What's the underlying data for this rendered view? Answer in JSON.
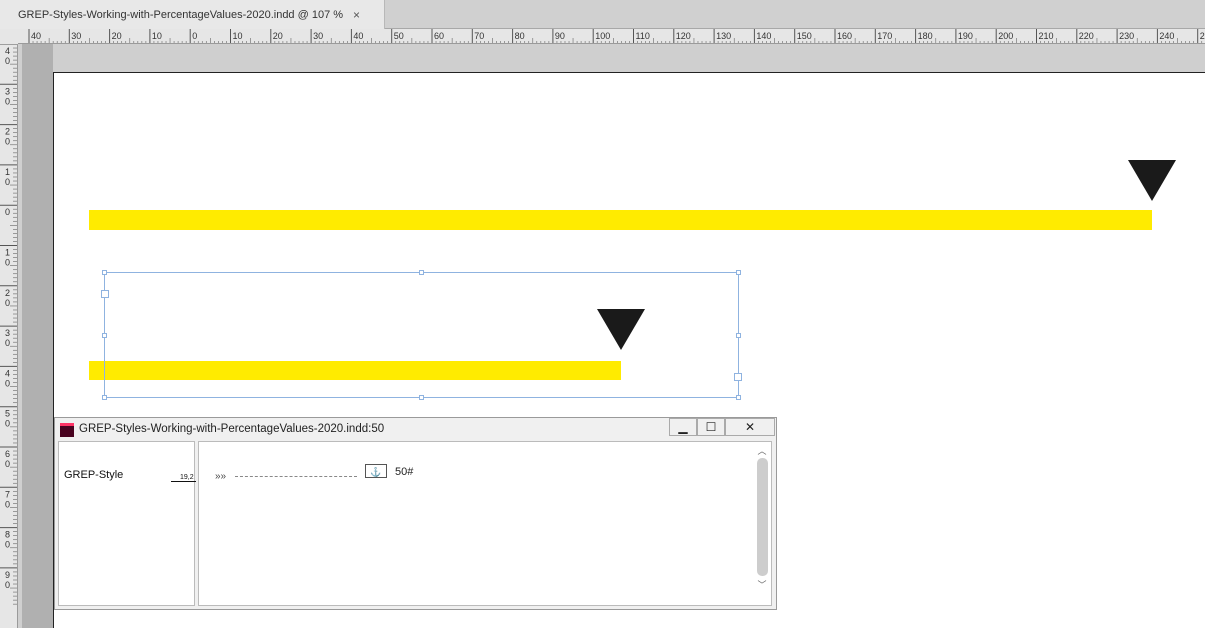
{
  "document_tab": {
    "title": "GREP-Styles-Working-with-PercentageValues-2020.indd @ 107 %",
    "close": "×"
  },
  "ruler": {
    "horizontal_labels": [
      "40",
      "30",
      "20",
      "10",
      "0",
      "10",
      "20",
      "30",
      "40",
      "50",
      "60",
      "70",
      "80",
      "90",
      "100",
      "110",
      "120",
      "130",
      "140",
      "150",
      "160",
      "170",
      "180",
      "190",
      "200",
      "210",
      "220",
      "230",
      "240",
      "2"
    ],
    "vertical_labels": [
      "40",
      "30",
      "20",
      "10",
      "0",
      "10",
      "20",
      "30",
      "40",
      "50",
      "60",
      "70",
      "80",
      "90"
    ]
  },
  "canvas": {
    "bar_color": "#ffeb00",
    "marker_color": "#1a1a1a",
    "bars": [
      {
        "name": "full-percentage-bar",
        "fill_percent": 100
      },
      {
        "name": "partial-percentage-bar",
        "fill_percent": 50
      }
    ]
  },
  "story_editor": {
    "title": "GREP-Styles-Working-with-PercentageValues-2020.indd:50",
    "minimize": "▁",
    "maximize": "☐",
    "close": "✕",
    "style_name": "GREP-Style",
    "style_size": "19,2",
    "text_marks": "»»",
    "anchor_symbol": "⚓",
    "text_content": "50#"
  }
}
